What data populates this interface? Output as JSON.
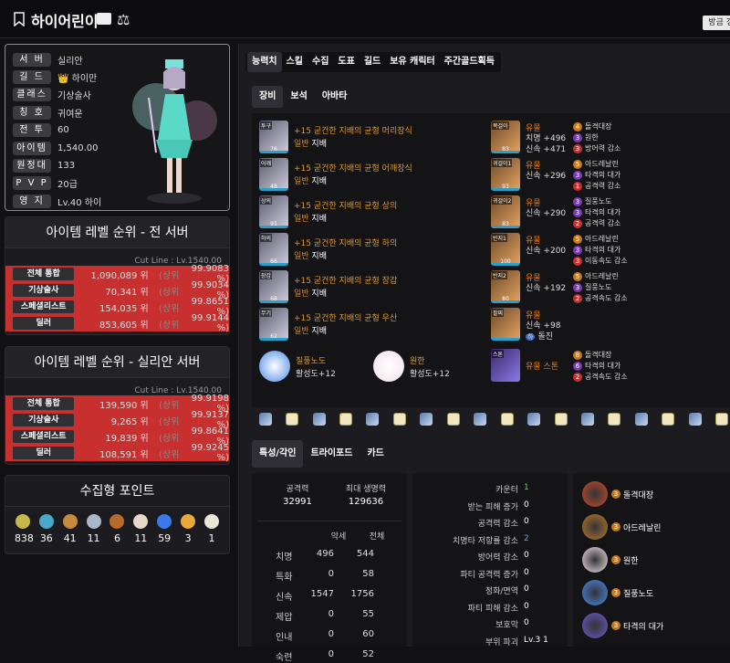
{
  "header": {
    "name": "하이어린이",
    "right_btn": "방금 갱"
  },
  "profile": [
    {
      "k": "서 버",
      "v": "실리안"
    },
    {
      "k": "길 드",
      "v": "하이만"
    },
    {
      "k": "클래스",
      "v": "기상술사"
    },
    {
      "k": "칭 호",
      "v": "귀여운"
    },
    {
      "k": "전 투",
      "v": "60"
    },
    {
      "k": "아이템",
      "v": "1,540.00"
    },
    {
      "k": "원정대",
      "v": "133"
    },
    {
      "k": "P V P",
      "v": "20급"
    },
    {
      "k": "영 지",
      "v": "Lv.40 하이"
    }
  ],
  "rank_all": {
    "title": "아이템 레벨 순위 - 전 서버",
    "cutline": "Cut Line : Lv.1540.00",
    "rows": [
      {
        "l": "전체 통합",
        "n": "1,090,089 위",
        "s": "(상위",
        "p": "99.9083 %)"
      },
      {
        "l": "기상술사",
        "n": "70,341 위",
        "s": "(상위",
        "p": "99.9034 %)"
      },
      {
        "l": "스페셜리스트",
        "n": "154,035 위",
        "s": "(상위",
        "p": "99.8651 %)"
      },
      {
        "l": "딜러",
        "n": "853,605 위",
        "s": "(상위",
        "p": "99.9144 %)"
      }
    ]
  },
  "rank_srv": {
    "title": "아이템 레벨 순위 - 실리안 서버",
    "cutline": "Cut Line : Lv.1540.00",
    "rows": [
      {
        "l": "전체 통합",
        "n": "139,590 위",
        "s": "(상위",
        "p": "99.9198 %)"
      },
      {
        "l": "기상술사",
        "n": "9,265 위",
        "s": "(상위",
        "p": "99.9137 %)"
      },
      {
        "l": "스페셜리스트",
        "n": "19,839 위",
        "s": "(상위",
        "p": "99.8641 %)"
      },
      {
        "l": "딜러",
        "n": "108,591 위",
        "s": "(상위",
        "p": "99.9245 %)"
      }
    ]
  },
  "collect": {
    "title": "수집형 포인트",
    "values": [
      "838",
      "36",
      "41",
      "11",
      "6",
      "11",
      "59",
      "3",
      "1"
    ],
    "icons": [
      "#c8b84a",
      "#4aa8c8",
      "#c88a3a",
      "#a8b8c8",
      "#b86a2a",
      "#e8d8c8",
      "#3a7ae8",
      "#e8a83a",
      "#e8e8d8"
    ]
  },
  "tabs": [
    "능력치",
    "스킬",
    "수집",
    "도표",
    "길드",
    "보유 캐릭터",
    "주간골드획득"
  ],
  "subtabs": [
    "장비",
    "보석",
    "아바타"
  ],
  "equip": [
    {
      "slot": "투구",
      "lv": "76",
      "name": "+15 굳건한 지배의 균형 머리장식",
      "g1": "일반",
      "g2": "지배"
    },
    {
      "slot": "어깨",
      "lv": "48",
      "name": "+15 굳건한 지배의 균형 어깨장식",
      "g1": "일반",
      "g2": "지배"
    },
    {
      "slot": "상의",
      "lv": "91",
      "name": "+15 굳건한 지배의 균형 상의",
      "g1": "일반",
      "g2": "지배"
    },
    {
      "slot": "하의",
      "lv": "66",
      "name": "+15 굳건한 지배의 균형 하의",
      "g1": "일반",
      "g2": "지배"
    },
    {
      "slot": "장갑",
      "lv": "68",
      "name": "+15 굳건한 지배의 균형 장갑",
      "g1": "일반",
      "g2": "지배"
    },
    {
      "slot": "무기",
      "lv": "62",
      "name": "+15 굳건한 지배의 균형 우산",
      "g1": "일반",
      "g2": "지배"
    }
  ],
  "acc": [
    {
      "slot": "목걸이",
      "lv": "83",
      "gr": "유물",
      "s1": "치명 +496",
      "s2": "신속 +471",
      "ef": [
        [
          "4",
          "돌격대장",
          "o"
        ],
        [
          "3",
          "원한",
          "p"
        ],
        [
          "3",
          "방어력 감소",
          "r"
        ]
      ]
    },
    {
      "slot": "귀걸이1",
      "lv": "93",
      "gr": "유물",
      "s1": "신속 +296",
      "s2": "",
      "ef": [
        [
          "5",
          "아드레날린",
          "o"
        ],
        [
          "3",
          "타격의 대가",
          "p"
        ],
        [
          "1",
          "공격력 감소",
          "r"
        ]
      ]
    },
    {
      "slot": "귀걸이2",
      "lv": "83",
      "gr": "유물",
      "s1": "신속 +290",
      "s2": "",
      "ef": [
        [
          "3",
          "질풍노도",
          "p"
        ],
        [
          "3",
          "타격의 대가",
          "p"
        ],
        [
          "2",
          "공격력 감소",
          "r"
        ]
      ]
    },
    {
      "slot": "반지1",
      "lv": "100",
      "gr": "유물",
      "s1": "신속 +200",
      "s2": "",
      "ef": [
        [
          "5",
          "아드레날린",
          "o"
        ],
        [
          "3",
          "타격의 대가",
          "p"
        ],
        [
          "3",
          "이동속도 감소",
          "r"
        ]
      ]
    },
    {
      "slot": "반지2",
      "lv": "80",
      "gr": "유물",
      "s1": "신속 +192",
      "s2": "",
      "ef": [
        [
          "5",
          "아드레날린",
          "o"
        ],
        [
          "3",
          "질풍노도",
          "p"
        ],
        [
          "2",
          "공격속도 감소",
          "r"
        ]
      ]
    },
    {
      "slot": "팔찌",
      "lv": "",
      "gr": "유물",
      "s1": "신속 +98",
      "s2": "돌진",
      "badge": "하",
      "ef": []
    }
  ],
  "stones": [
    {
      "n": "질풍노도",
      "v": "활성도+12",
      "c": "#4a8ae8"
    },
    {
      "n": "원한",
      "v": "활성도+12",
      "c": "#f0e0e8"
    }
  ],
  "astone": {
    "slot": "스톤",
    "gr": "유물 스톤",
    "ef": [
      [
        "8",
        "돌격대장",
        "o"
      ],
      [
        "6",
        "타격의 대가",
        "p"
      ],
      [
        "2",
        "공격속도 감소",
        "r"
      ]
    ]
  },
  "gems_count": 18,
  "subtabs2": [
    "특성/각인",
    "트라이포드",
    "카드"
  ],
  "base": {
    "atk_l": "공격력",
    "atk_v": "32991",
    "hp_l": "최대 생명력",
    "hp_v": "129636"
  },
  "traits": {
    "h1": "악세",
    "h2": "전체",
    "rows": [
      [
        "치명",
        "496",
        "544"
      ],
      [
        "특화",
        "0",
        "58"
      ],
      [
        "신속",
        "1547",
        "1756"
      ],
      [
        "제압",
        "0",
        "55"
      ],
      [
        "인내",
        "0",
        "60"
      ],
      [
        "숙련",
        "0",
        "52"
      ]
    ]
  },
  "props": [
    [
      "카운터",
      "1"
    ],
    [
      "받는 피해 증가",
      "0"
    ],
    [
      "공격력 감소",
      "0"
    ],
    [
      "치명타 저항률 감소",
      "2"
    ],
    [
      "방어력 감소",
      "0"
    ],
    [
      "파티 공격력 증가",
      "0"
    ],
    [
      "정화/면역",
      "0"
    ],
    [
      "파티 피해 감소",
      "0"
    ],
    [
      "보호막",
      "0"
    ],
    [
      "부위 파괴",
      "Lv.3 1"
    ]
  ],
  "engr": [
    {
      "l": "3",
      "n": "돌격대장",
      "c": "#c84a2a"
    },
    {
      "l": "3",
      "n": "아드레날린",
      "c": "#b8782a"
    },
    {
      "l": "3",
      "n": "원한",
      "c": "#f0e0e8"
    },
    {
      "l": "3",
      "n": "질풍노도",
      "c": "#4a8ae8"
    },
    {
      "l": "3",
      "n": "타격의 대가",
      "c": "#6a5ac8"
    }
  ]
}
